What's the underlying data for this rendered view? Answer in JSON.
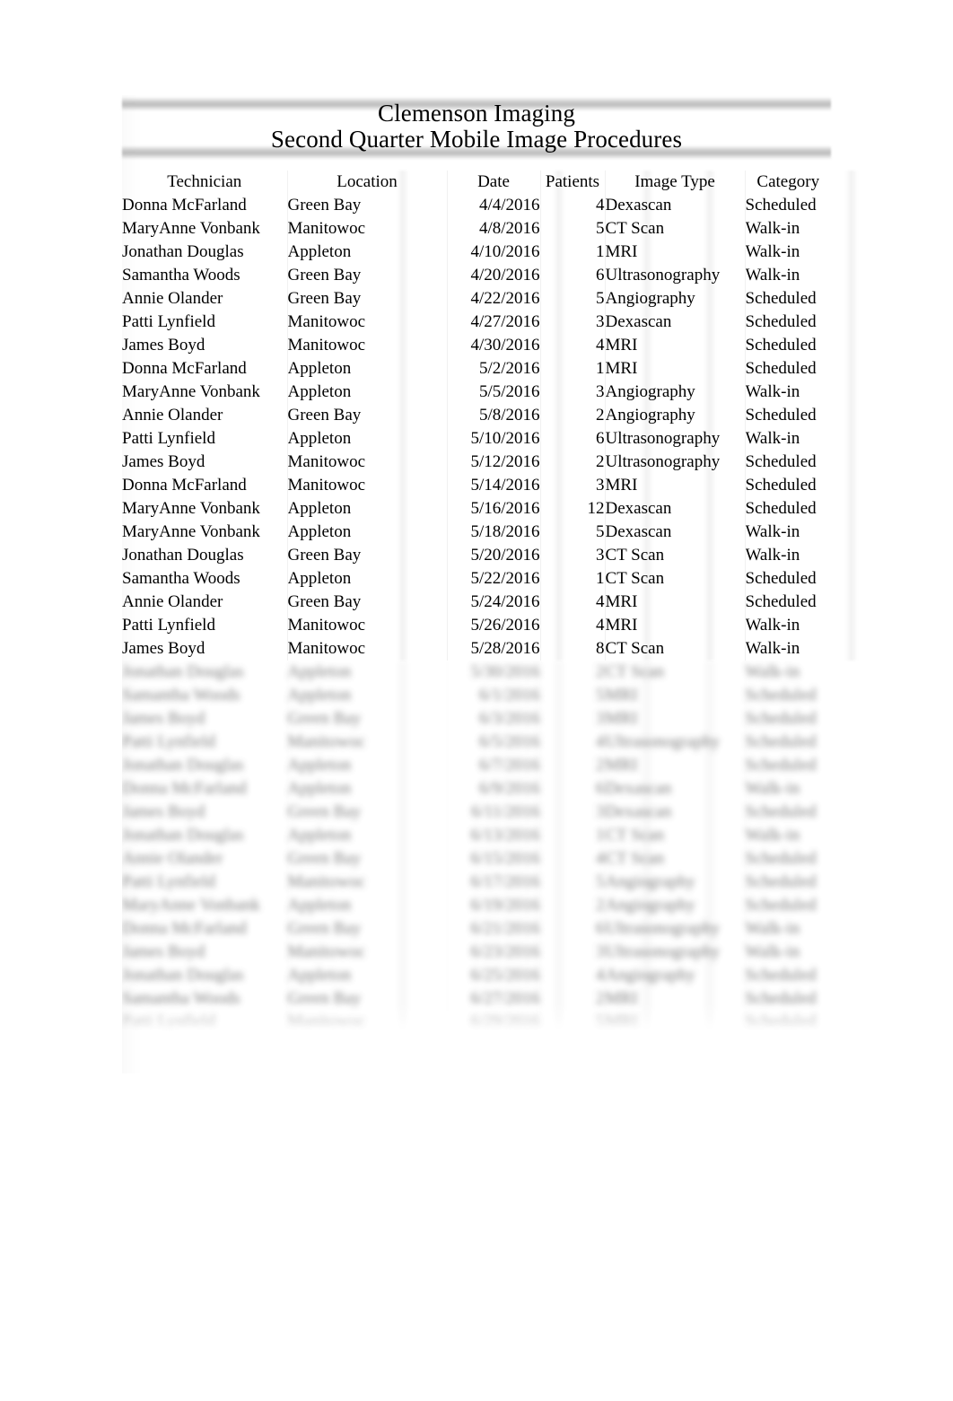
{
  "document": {
    "title_line1": "Clemenson Imaging",
    "title_line2": "Second Quarter Mobile Image Procedures"
  },
  "table": {
    "columns": [
      {
        "key": "technician",
        "label": "Technician"
      },
      {
        "key": "location",
        "label": "Location"
      },
      {
        "key": "date",
        "label": "Date"
      },
      {
        "key": "patients",
        "label": "Patients"
      },
      {
        "key": "image_type",
        "label": "Image Type"
      },
      {
        "key": "category",
        "label": "Category"
      }
    ],
    "rows": [
      {
        "technician": "Donna McFarland",
        "location": "Green Bay",
        "date": "4/4/2016",
        "patients": "4",
        "image_type": "Dexascan",
        "category": "Scheduled"
      },
      {
        "technician": "MaryAnne Vonbank",
        "location": "Manitowoc",
        "date": "4/8/2016",
        "patients": "5",
        "image_type": "CT Scan",
        "category": "Walk-in"
      },
      {
        "technician": "Jonathan Douglas",
        "location": "Appleton",
        "date": "4/10/2016",
        "patients": "1",
        "image_type": "MRI",
        "category": "Walk-in"
      },
      {
        "technician": "Samantha Woods",
        "location": "Green Bay",
        "date": "4/20/2016",
        "patients": "6",
        "image_type": "Ultrasonography",
        "category": "Walk-in"
      },
      {
        "technician": "Annie Olander",
        "location": "Green Bay",
        "date": "4/22/2016",
        "patients": "5",
        "image_type": "Angiography",
        "category": "Scheduled"
      },
      {
        "technician": "Patti Lynfield",
        "location": "Manitowoc",
        "date": "4/27/2016",
        "patients": "3",
        "image_type": "Dexascan",
        "category": "Scheduled"
      },
      {
        "technician": "James Boyd",
        "location": "Manitowoc",
        "date": "4/30/2016",
        "patients": "4",
        "image_type": "MRI",
        "category": "Scheduled"
      },
      {
        "technician": "Donna McFarland",
        "location": "Appleton",
        "date": "5/2/2016",
        "patients": "1",
        "image_type": "MRI",
        "category": "Scheduled"
      },
      {
        "technician": "MaryAnne Vonbank",
        "location": "Appleton",
        "date": "5/5/2016",
        "patients": "3",
        "image_type": "Angiography",
        "category": "Walk-in"
      },
      {
        "technician": "Annie Olander",
        "location": "Green Bay",
        "date": "5/8/2016",
        "patients": "2",
        "image_type": "Angiography",
        "category": "Scheduled"
      },
      {
        "technician": "Patti Lynfield",
        "location": "Appleton",
        "date": "5/10/2016",
        "patients": "6",
        "image_type": "Ultrasonography",
        "category": "Walk-in"
      },
      {
        "technician": "James Boyd",
        "location": "Manitowoc",
        "date": "5/12/2016",
        "patients": "2",
        "image_type": "Ultrasonography",
        "category": "Scheduled"
      },
      {
        "technician": "Donna McFarland",
        "location": "Manitowoc",
        "date": "5/14/2016",
        "patients": "3",
        "image_type": "MRI",
        "category": "Scheduled"
      },
      {
        "technician": "MaryAnne Vonbank",
        "location": "Appleton",
        "date": "5/16/2016",
        "patients": "12",
        "image_type": "Dexascan",
        "category": "Scheduled"
      },
      {
        "technician": "MaryAnne Vonbank",
        "location": "Appleton",
        "date": "5/18/2016",
        "patients": "5",
        "image_type": "Dexascan",
        "category": "Walk-in"
      },
      {
        "technician": "Jonathan Douglas",
        "location": "Green Bay",
        "date": "5/20/2016",
        "patients": "3",
        "image_type": "CT Scan",
        "category": "Walk-in"
      },
      {
        "technician": "Samantha Woods",
        "location": "Appleton",
        "date": "5/22/2016",
        "patients": "1",
        "image_type": "CT Scan",
        "category": "Scheduled"
      },
      {
        "technician": "Annie Olander",
        "location": "Green Bay",
        "date": "5/24/2016",
        "patients": "4",
        "image_type": "MRI",
        "category": "Scheduled"
      },
      {
        "technician": "Patti Lynfield",
        "location": "Manitowoc",
        "date": "5/26/2016",
        "patients": "4",
        "image_type": "MRI",
        "category": "Walk-in"
      },
      {
        "technician": "James Boyd",
        "location": "Manitowoc",
        "date": "5/28/2016",
        "patients": "8",
        "image_type": "CT Scan",
        "category": "Walk-in"
      }
    ],
    "blurred_rows": [
      {
        "technician": "Jonathan Douglas",
        "location": "Appleton",
        "date": "5/30/2016",
        "patients": "2",
        "image_type": "CT Scan",
        "category": "Walk-in"
      },
      {
        "technician": "Samantha Woods",
        "location": "Appleton",
        "date": "6/1/2016",
        "patients": "5",
        "image_type": "MRI",
        "category": "Scheduled"
      },
      {
        "technician": "James Boyd",
        "location": "Green Bay",
        "date": "6/3/2016",
        "patients": "3",
        "image_type": "MRI",
        "category": "Scheduled"
      },
      {
        "technician": "Patti Lynfield",
        "location": "Manitowoc",
        "date": "6/5/2016",
        "patients": "4",
        "image_type": "Ultrasonography",
        "category": "Scheduled"
      },
      {
        "technician": "Jonathan Douglas",
        "location": "Appleton",
        "date": "6/7/2016",
        "patients": "2",
        "image_type": "MRI",
        "category": "Scheduled"
      },
      {
        "technician": "Donna McFarland",
        "location": "Appleton",
        "date": "6/9/2016",
        "patients": "6",
        "image_type": "Dexascan",
        "category": "Walk-in"
      },
      {
        "technician": "James Boyd",
        "location": "Green Bay",
        "date": "6/11/2016",
        "patients": "3",
        "image_type": "Dexascan",
        "category": "Scheduled"
      },
      {
        "technician": "Jonathan Douglas",
        "location": "Appleton",
        "date": "6/13/2016",
        "patients": "1",
        "image_type": "CT Scan",
        "category": "Walk-in"
      },
      {
        "technician": "Annie Olander",
        "location": "Green Bay",
        "date": "6/15/2016",
        "patients": "4",
        "image_type": "CT Scan",
        "category": "Scheduled"
      },
      {
        "technician": "Patti Lynfield",
        "location": "Manitowoc",
        "date": "6/17/2016",
        "patients": "5",
        "image_type": "Angiography",
        "category": "Scheduled"
      },
      {
        "technician": "MaryAnne Vonbank",
        "location": "Appleton",
        "date": "6/19/2016",
        "patients": "2",
        "image_type": "Angiography",
        "category": "Scheduled"
      },
      {
        "technician": "Donna McFarland",
        "location": "Green Bay",
        "date": "6/21/2016",
        "patients": "6",
        "image_type": "Ultrasonography",
        "category": "Walk-in"
      },
      {
        "technician": "James Boyd",
        "location": "Manitowoc",
        "date": "6/23/2016",
        "patients": "3",
        "image_type": "Ultrasonography",
        "category": "Walk-in"
      },
      {
        "technician": "Jonathan Douglas",
        "location": "Appleton",
        "date": "6/25/2016",
        "patients": "4",
        "image_type": "Angiography",
        "category": "Scheduled"
      },
      {
        "technician": "Samantha Woods",
        "location": "Green Bay",
        "date": "6/27/2016",
        "patients": "2",
        "image_type": "MRI",
        "category": "Scheduled"
      },
      {
        "technician": "Patti Lynfield",
        "location": "Manitowoc",
        "date": "6/29/2016",
        "patients": "5",
        "image_type": "MRI",
        "category": "Scheduled"
      }
    ]
  }
}
